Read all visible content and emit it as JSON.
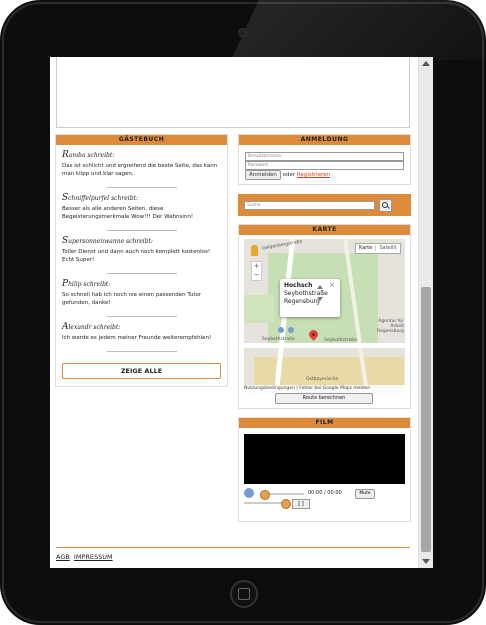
{
  "guestbook": {
    "title": "GÄSTEBUCH",
    "entries": [
      {
        "initial": "R",
        "author": "amba schreibt:",
        "text": "Das ist schlicht und ergreifend die beste Seite, das kann man klipp und klar sagen."
      },
      {
        "initial": "S",
        "author": "chniffelpurfel schreibt:",
        "text": "Besser als alle anderen Seiten, diese Begeisterungsmerkmale Wow!!! Der Wahnsinn!"
      },
      {
        "initial": "S",
        "author": "upersonnenwanne schreibt:",
        "text": "Toller Dienst und dann auch noch komplett kostenlos! Echt Super!"
      },
      {
        "initial": "P",
        "author": "hilip schreibt:",
        "text": "So schnell hab ich noch nie einen passenden Tutor gefunden, danke!"
      },
      {
        "initial": "A",
        "author": "lexandr schreibt:",
        "text": "Ich werde es jedem meiner Freunde weiterempfehlen!"
      }
    ],
    "show_all": "ZEIGE ALLE"
  },
  "login": {
    "title": "ANMELDUNG",
    "username_placeholder": "Benutzername",
    "password_placeholder": "Passwort",
    "login_button": "Anmelden",
    "or_text": "oder",
    "register_link": "Registrieren"
  },
  "search": {
    "placeholder": "Suche"
  },
  "map": {
    "title": "KARTE",
    "type_map": "Karte",
    "type_sat": "Satellit",
    "info_title": "Hochsch",
    "info_line2": "Seybothstraße",
    "info_line3": "Regensburg",
    "street_label": "Seybothstraße",
    "street_label2": "Seybothstraße",
    "label_agentur": "Agentur für Arbeit Regensburg",
    "label_galgenberg": "Galgenbergstraße",
    "label_ostbayern": "Ostbayerische",
    "footer_text": "Nutzungsbedingungen | Fehler bei Google Maps melden",
    "route_button": "Route berechnen"
  },
  "film": {
    "title": "FILM",
    "time": "00:00 / 00:00",
    "mute_label": "Mute",
    "fullscreen_label": "[ ]"
  },
  "footer": {
    "agb": "AGB",
    "impressum": "IMPRESSUM"
  }
}
